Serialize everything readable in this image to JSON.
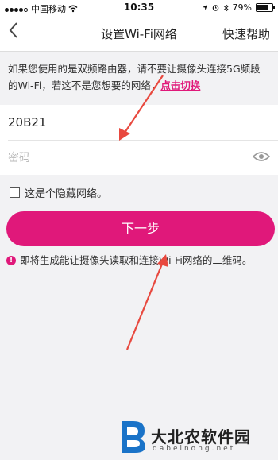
{
  "status_bar": {
    "carrier": "中国移动",
    "time": "10:35",
    "battery": "79%",
    "battery_level": 0.79
  },
  "navbar": {
    "title": "设置Wi-Fi网络",
    "help_label": "快速帮助",
    "back_icon": "chevron-left-icon"
  },
  "notice": {
    "text": "如果您使用的是双频路由器，请不要让摄像头连接5G频段的Wi-Fi，若这不是您想要的网络，",
    "link_label": "点击切换"
  },
  "form": {
    "ssid_value": "20B21",
    "password_placeholder": "密码",
    "password_value": ""
  },
  "hidden_network": {
    "label": "这是个隐藏网络。",
    "checked": false
  },
  "next_button": {
    "label": "下一步"
  },
  "info": {
    "text": "即将生成能让摄像头读取和连接Wi-Fi网络的二维码。"
  },
  "watermark": {
    "name": "大北农软件园",
    "url": "dabeinong.net"
  },
  "colors": {
    "accent": "#e0187a",
    "arrow": "#e8493f"
  }
}
